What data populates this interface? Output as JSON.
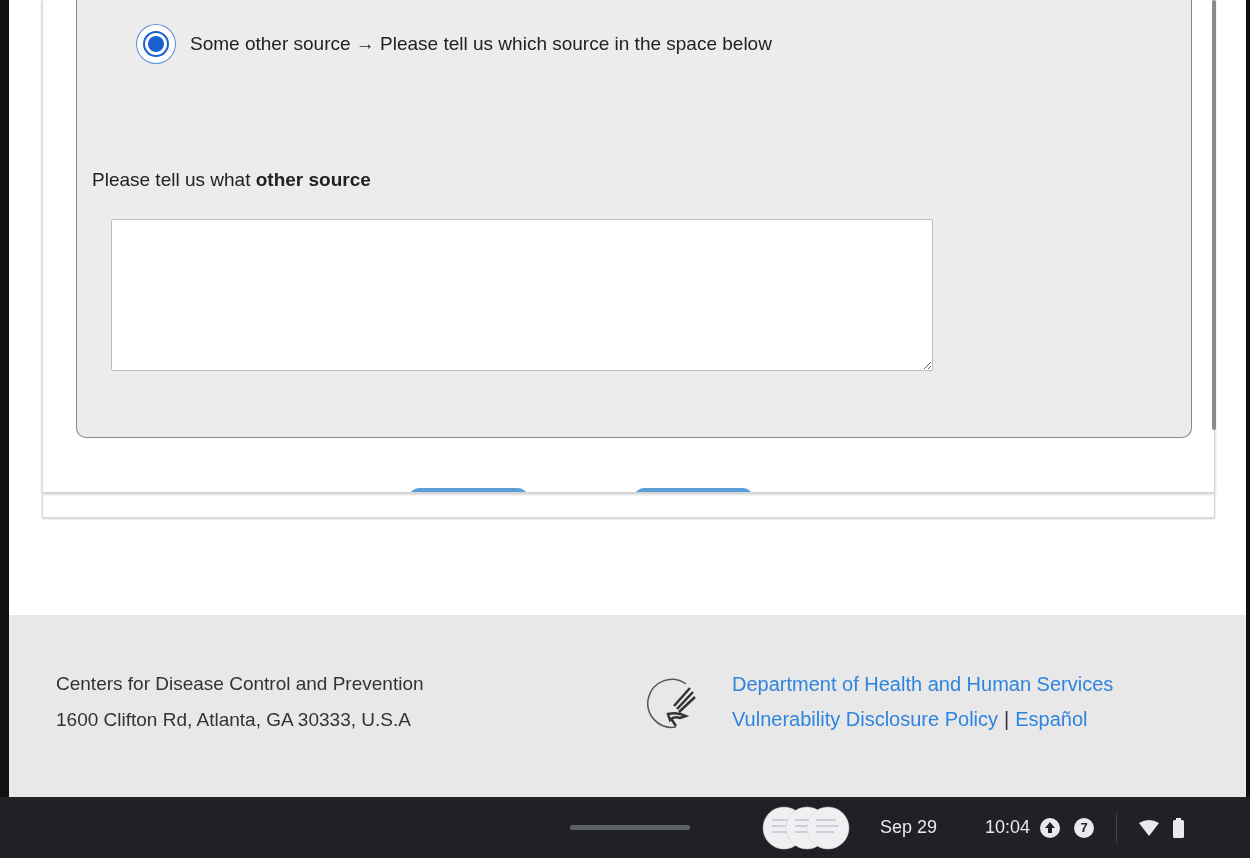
{
  "form": {
    "radio": {
      "label": "Some other source → Please tell us which source in the space below",
      "selected": true
    },
    "other_source": {
      "label": "Please tell us what **other source**"
    }
  },
  "footer": {
    "org_lines": [
      "Centers for Disease Control and Prevention",
      "1600 Clifton Rd, Atlanta, GA 30333, U.S.A"
    ],
    "links": [
      {
        "text": "Department of Health and Human Services"
      },
      {
        "text": "Vulnerability Disclosure Policy"
      },
      {
        "text": "Español"
      }
    ],
    "separator": "|"
  },
  "taskbar": {
    "date": "Sep 29",
    "time": "10:04",
    "notification_count": "7"
  }
}
